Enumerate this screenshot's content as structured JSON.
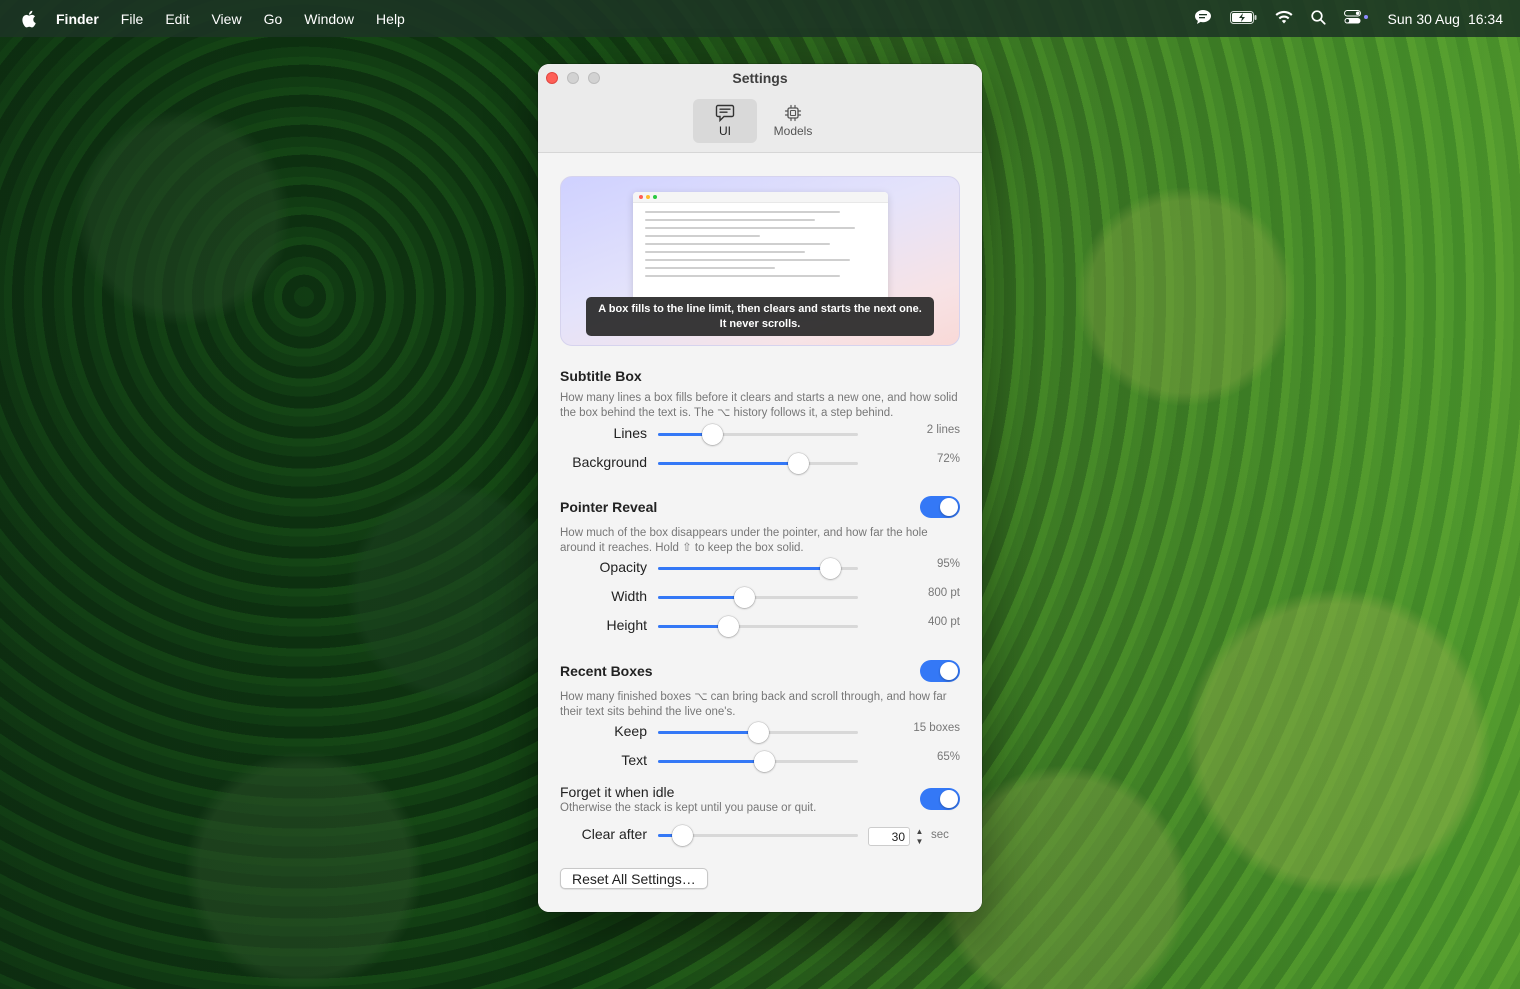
{
  "menubar": {
    "app": "Finder",
    "items": [
      "File",
      "Edit",
      "View",
      "Go",
      "Window",
      "Help"
    ],
    "date": "Sun 30 Aug",
    "time": "16:34",
    "icons": [
      "apple-icon",
      "messages-icon",
      "battery-icon",
      "wifi-icon",
      "spotlight-icon",
      "control-center-icon"
    ]
  },
  "window": {
    "title": "Settings",
    "tabs": [
      {
        "label": "UI",
        "icon": "chat-bubble-icon",
        "active": true
      },
      {
        "label": "Models",
        "icon": "chip-icon",
        "active": false
      }
    ]
  },
  "preview": {
    "caption": "A box fills to the line limit, then clears and starts the next one. It never scrolls."
  },
  "subtitle_box": {
    "title": "Subtitle Box",
    "description": "How many lines a box fills before it clears and starts a new one, and how solid the box behind the text is. The ⌥ history follows it, a step behind.",
    "sliders": [
      {
        "label": "Lines",
        "value": "2 lines",
        "fraction": 0.27
      },
      {
        "label": "Background",
        "value": "72%",
        "fraction": 0.7
      }
    ]
  },
  "pointer_reveal": {
    "title": "Pointer Reveal",
    "enabled": true,
    "description": "How much of the box disappears under the pointer, and how far the hole around it reaches. Hold ⇧ to keep the box solid.",
    "sliders": [
      {
        "label": "Opacity",
        "value": "95%",
        "fraction": 0.86
      },
      {
        "label": "Width",
        "value": "800 pt",
        "fraction": 0.43
      },
      {
        "label": "Height",
        "value": "400 pt",
        "fraction": 0.35
      }
    ]
  },
  "recent_boxes": {
    "title": "Recent Boxes",
    "enabled": true,
    "description": "How many finished boxes ⌥ can bring back and scroll through, and how far their text sits behind the live one's.",
    "sliders": [
      {
        "label": "Keep",
        "value": "15 boxes",
        "fraction": 0.5
      },
      {
        "label": "Text",
        "value": "65%",
        "fraction": 0.53
      }
    ],
    "forget": {
      "title": "Forget it when idle",
      "description": "Otherwise the stack is kept until you pause or quit.",
      "enabled": true,
      "clear_label": "Clear after",
      "clear_value": "30",
      "clear_fraction": 0.12,
      "unit": "sec"
    }
  },
  "reset_button": "Reset All Settings…",
  "colors": {
    "accent": "#3478f6",
    "close": "#fe5f57"
  }
}
